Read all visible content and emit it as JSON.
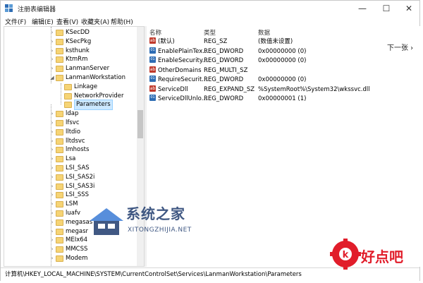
{
  "window": {
    "title": "注册表编辑器",
    "controls": {
      "minimize": "—",
      "maximize": "☐",
      "close": "✕"
    }
  },
  "menu": [
    "文件(F)",
    "编辑(E)",
    "查看(V)",
    "收藏夹(A)",
    "帮助(H)"
  ],
  "tree": {
    "items": [
      {
        "label": "KSecDD",
        "expanded": false,
        "level": 1
      },
      {
        "label": "KSecPkg",
        "expanded": false,
        "level": 1
      },
      {
        "label": "ksthunk",
        "expanded": false,
        "level": 1
      },
      {
        "label": "KtmRm",
        "expanded": false,
        "level": 1
      },
      {
        "label": "LanmanServer",
        "expanded": false,
        "level": 1
      },
      {
        "label": "LanmanWorkstation",
        "expanded": true,
        "level": 1
      },
      {
        "label": "Linkage",
        "level": 2
      },
      {
        "label": "NetworkProvider",
        "level": 2
      },
      {
        "label": "Parameters",
        "level": 2,
        "selected": true
      },
      {
        "label": "ldap",
        "level": 1
      },
      {
        "label": "lfsvc",
        "level": 1
      },
      {
        "label": "lltdio",
        "level": 1
      },
      {
        "label": "lltdsvc",
        "level": 1
      },
      {
        "label": "lmhosts",
        "level": 1
      },
      {
        "label": "Lsa",
        "level": 1
      },
      {
        "label": "LSI_SAS",
        "level": 1
      },
      {
        "label": "LSI_SAS2i",
        "level": 1
      },
      {
        "label": "LSI_SAS3i",
        "level": 1
      },
      {
        "label": "LSI_SSS",
        "level": 1
      },
      {
        "label": "LSM",
        "level": 1
      },
      {
        "label": "luafv",
        "level": 1
      },
      {
        "label": "megasas",
        "level": 1
      },
      {
        "label": "megasr",
        "level": 1
      },
      {
        "label": "MEIx64",
        "level": 1
      },
      {
        "label": "MMCSS",
        "level": 1
      },
      {
        "label": "Modem",
        "level": 1
      }
    ]
  },
  "values": {
    "headers": {
      "name": "名称",
      "type": "类型",
      "data": "数据"
    },
    "rows": [
      {
        "icon": "string-value-icon",
        "name": "(默认)",
        "type": "REG_SZ",
        "data": "(数值未设置)"
      },
      {
        "icon": "binary-value-icon",
        "name": "EnablePlainTex...",
        "type": "REG_DWORD",
        "data": "0x00000000 (0)"
      },
      {
        "icon": "binary-value-icon",
        "name": "EnableSecurity...",
        "type": "REG_DWORD",
        "data": "0x00000000 (0)"
      },
      {
        "icon": "string-value-icon",
        "name": "OtherDomains",
        "type": "REG_MULTI_SZ",
        "data": ""
      },
      {
        "icon": "binary-value-icon",
        "name": "RequireSecurit...",
        "type": "REG_DWORD",
        "data": "0x00000000 (0)"
      },
      {
        "icon": "string-value-icon",
        "name": "ServiceDll",
        "type": "REG_EXPAND_SZ",
        "data": "%SystemRoot%\\System32\\wkssvc.dll"
      },
      {
        "icon": "binary-value-icon",
        "name": "ServiceDllUnlo...",
        "type": "REG_DWORD",
        "data": "0x00000001 (1)"
      }
    ]
  },
  "next_page": "下一张 ›",
  "status": "计算机\\HKEY_LOCAL_MACHINE\\SYSTEM\\CurrentControlSet\\Services\\LanmanWorkstation\\Parameters",
  "watermarks": {
    "site1_name": "系统之家",
    "site1_url": "XITONGZHIJIA.NET",
    "site2_name": "好点吧"
  },
  "colors": {
    "selection": "#cce8ff",
    "folder": "#f6d475",
    "watermark_blue": "#1f3c6e",
    "watermark_red": "#e11d2a"
  }
}
